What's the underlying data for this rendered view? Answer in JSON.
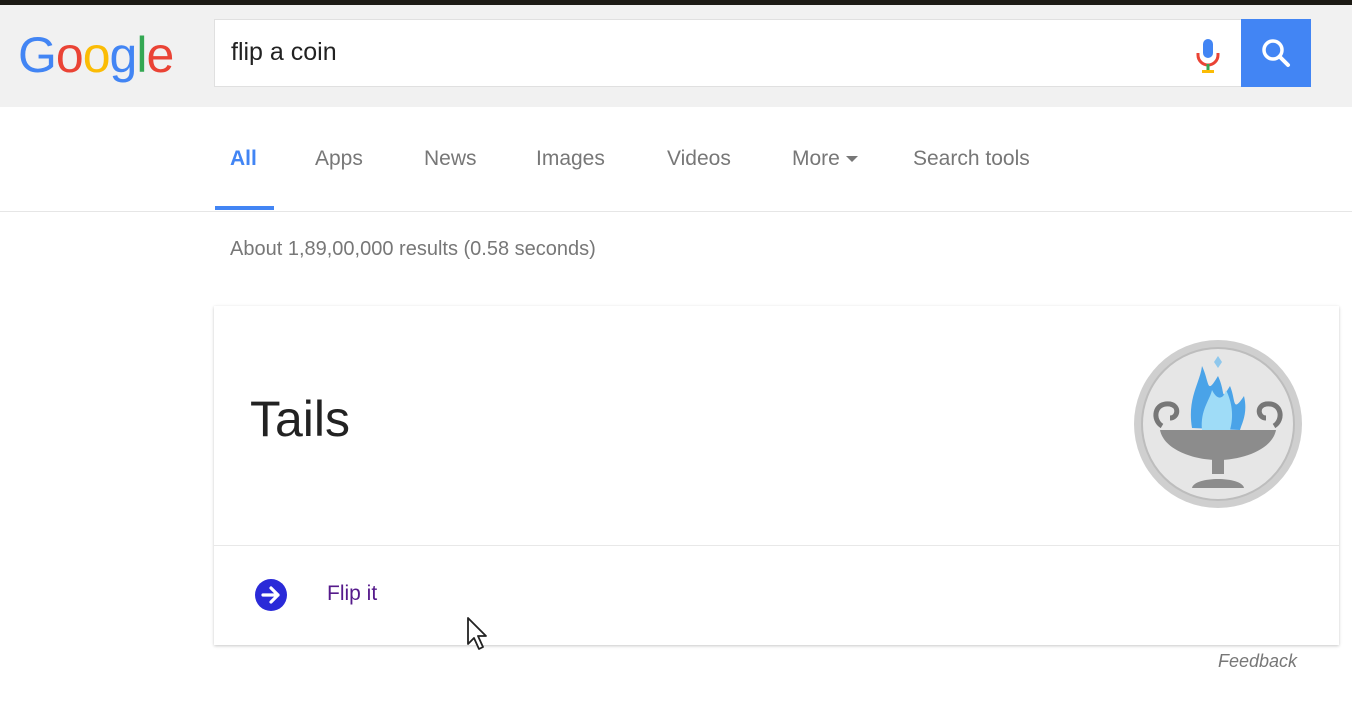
{
  "logo": {
    "text": "Google"
  },
  "search": {
    "query": "flip a coin"
  },
  "tabs": [
    {
      "label": "All",
      "active": true
    },
    {
      "label": "Apps"
    },
    {
      "label": "News"
    },
    {
      "label": "Images"
    },
    {
      "label": "Videos"
    },
    {
      "label": "More"
    },
    {
      "label": "Search tools"
    }
  ],
  "result_stats": "About 1,89,00,000 results (0.58 seconds)",
  "coin_card": {
    "result": "Tails",
    "coin_icon": "tails-coin-icon",
    "action_label": "Flip it",
    "action_icon": "arrow-right-circle-icon"
  },
  "feedback_label": "Feedback",
  "colors": {
    "accent": "#4285f4",
    "visited_link": "#551a8b",
    "arrow_circle": "#2a2ad8"
  }
}
